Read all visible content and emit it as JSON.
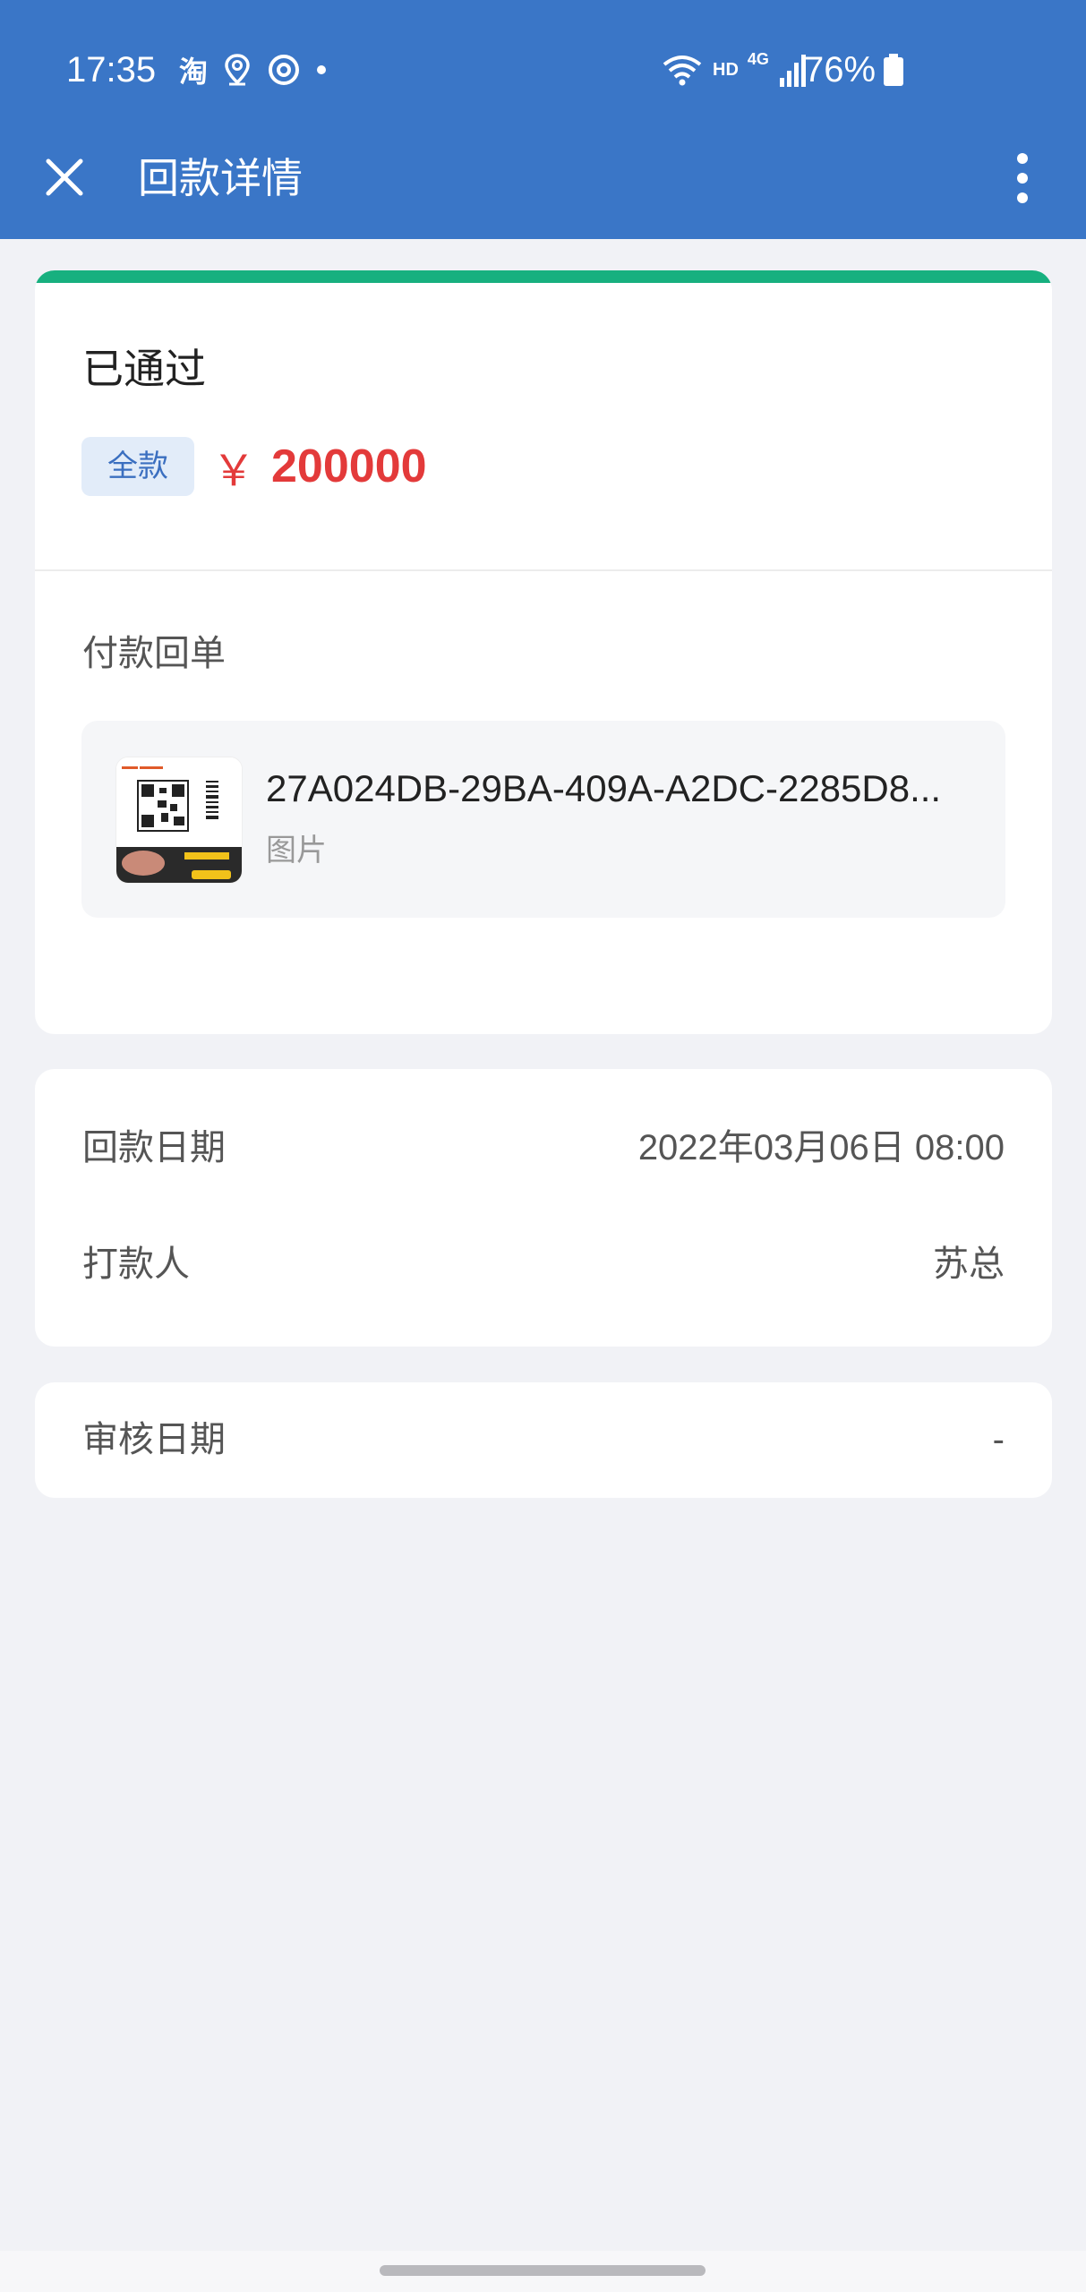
{
  "status_bar": {
    "time": "17:35",
    "battery": "76%",
    "network": "4G",
    "hd": "HD"
  },
  "header": {
    "title": "回款详情",
    "background_color": "#3a76c7"
  },
  "summary": {
    "status": "已通过",
    "tag": "全款",
    "currency": "￥",
    "amount": "200000",
    "accent_color": "#17b07f",
    "amount_color": "#e33a3a"
  },
  "receipt": {
    "section_label": "付款回单",
    "file_name": "27A024DB-29BA-409A-A2DC-2285D8...",
    "file_type": "图片"
  },
  "details": {
    "payment_date_label": "回款日期",
    "payment_date_value": "2022年03月06日 08:00",
    "payer_label": "打款人",
    "payer_value": "苏总"
  },
  "review": {
    "review_date_label": "审核日期",
    "review_date_value": "-"
  }
}
